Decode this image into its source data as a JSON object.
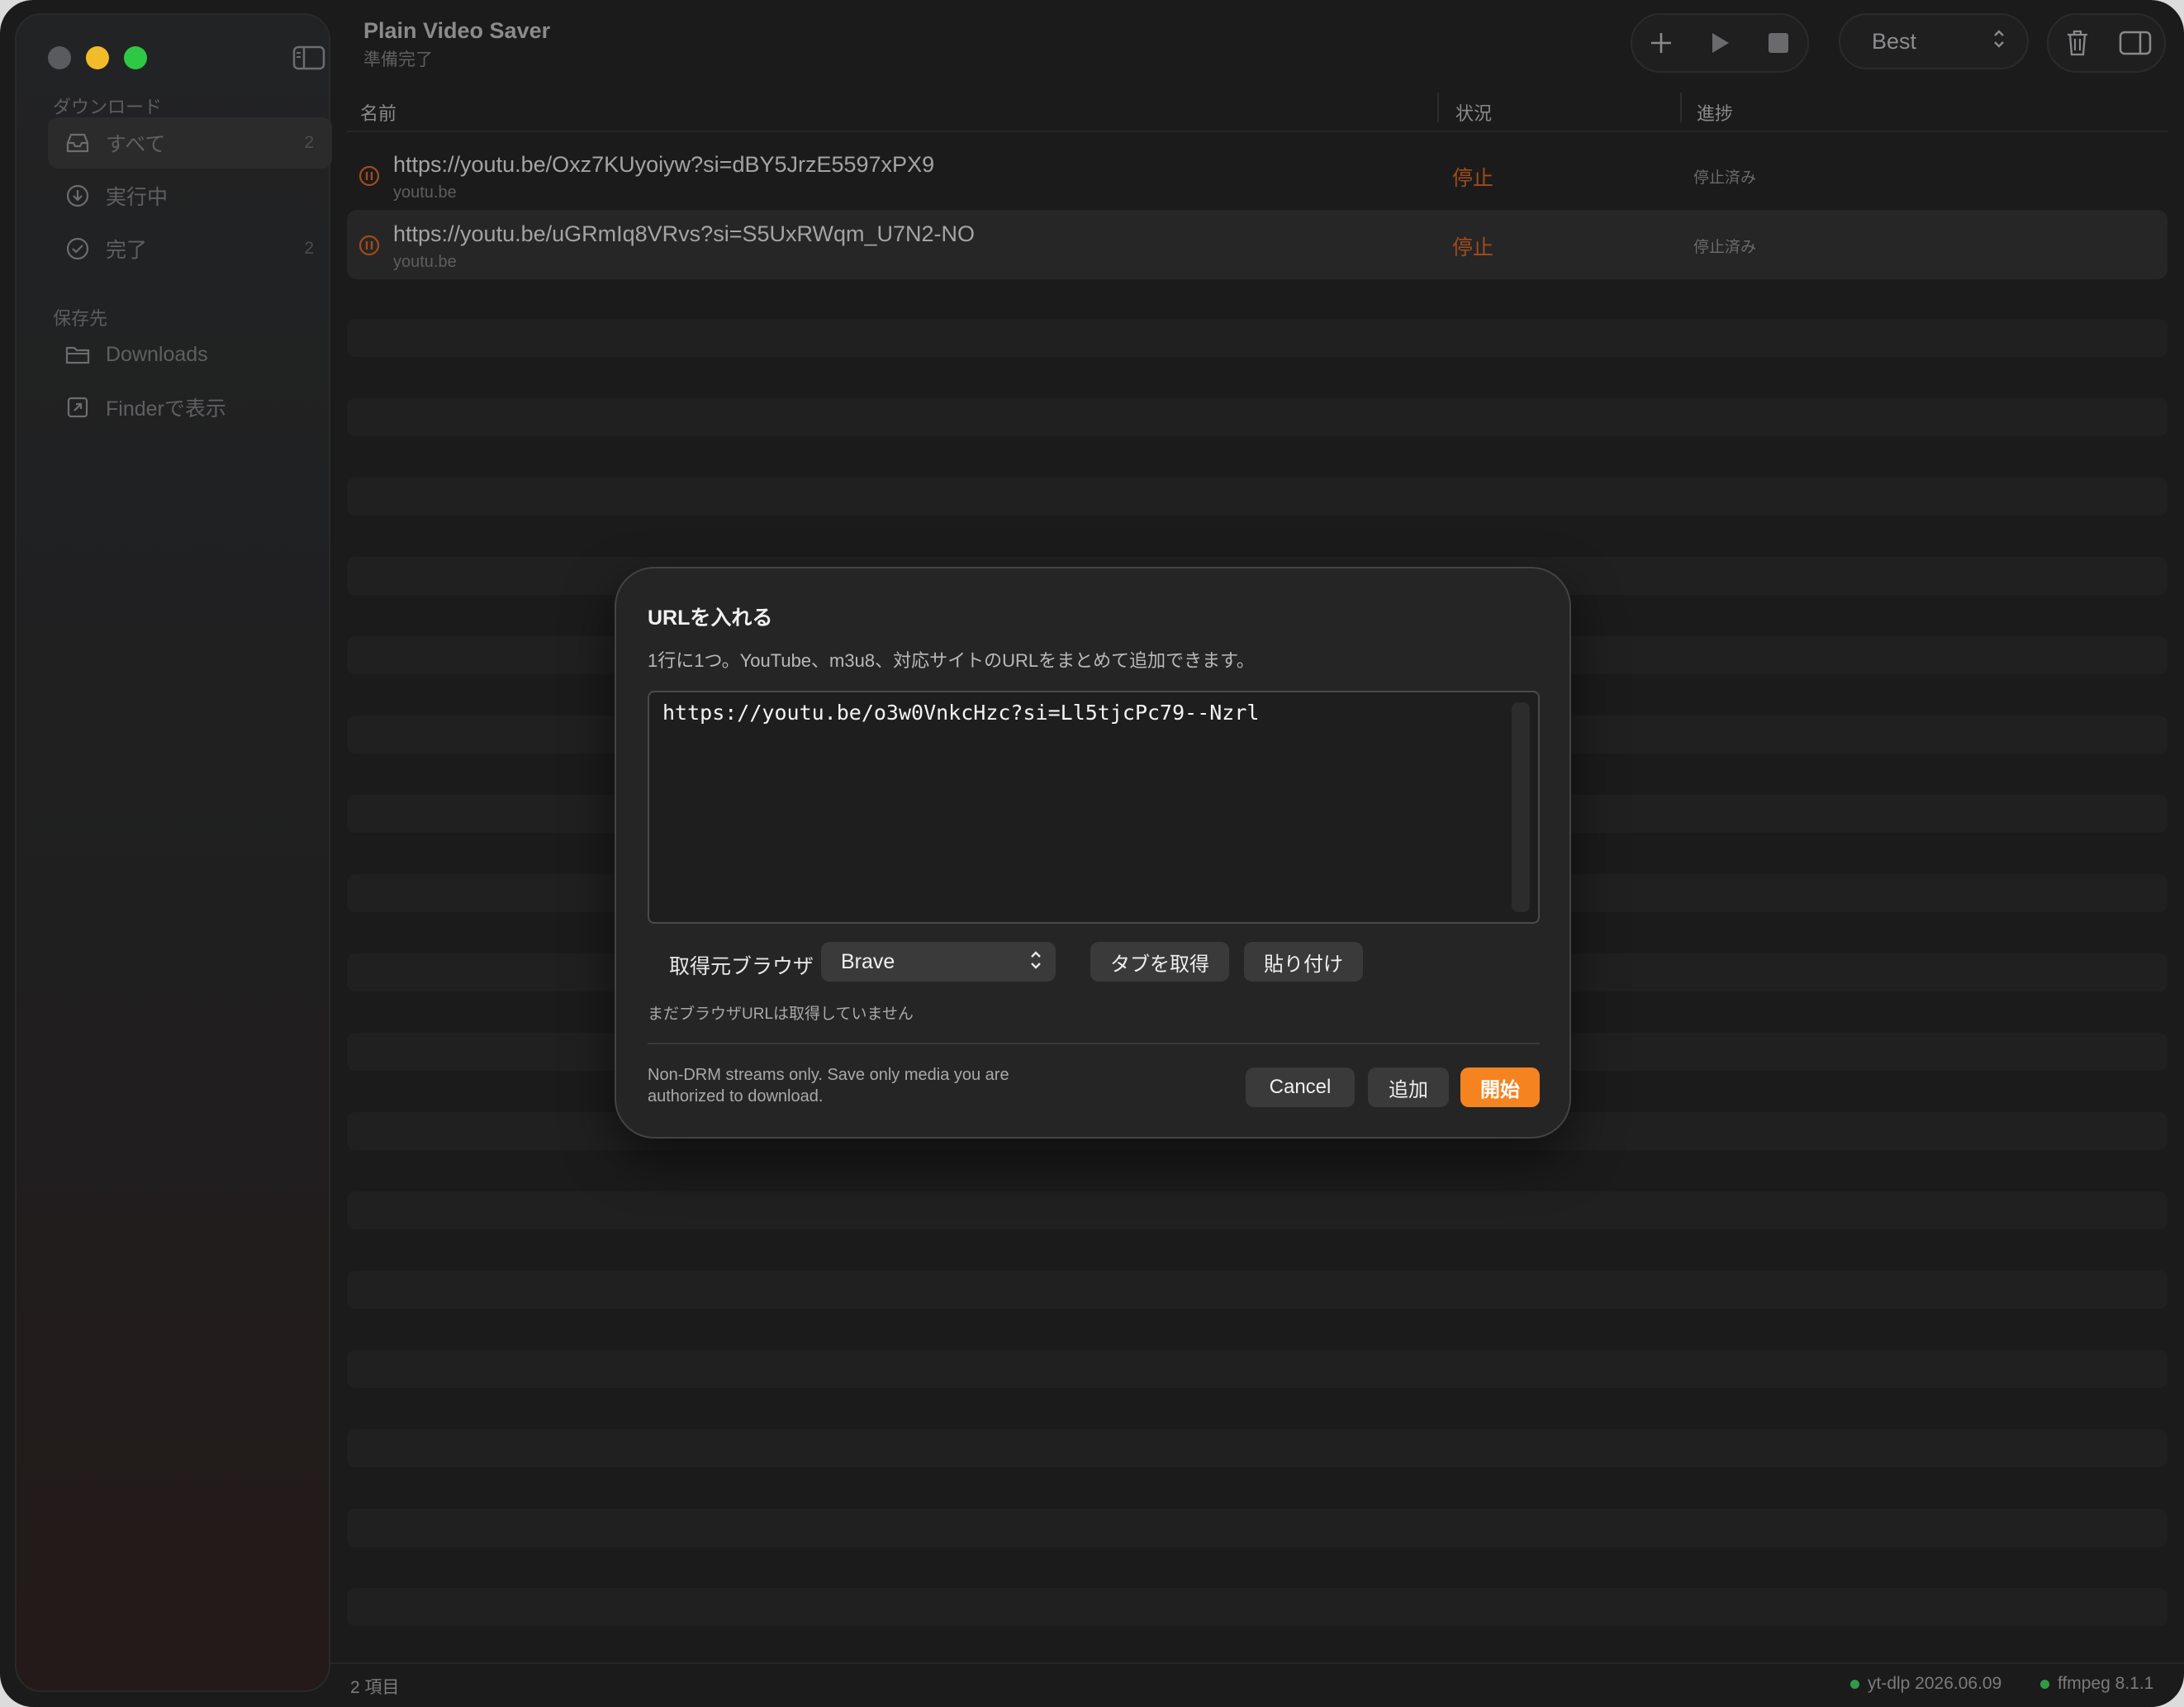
{
  "window": {
    "title": "Plain Video Saver",
    "subtitle": "準備完了"
  },
  "sidebar": {
    "downloads_section": "ダウンロード",
    "items": [
      {
        "label": "すべて",
        "count": "2",
        "icon": "tray-icon"
      },
      {
        "label": "実行中",
        "count": "",
        "icon": "download-circle-icon"
      },
      {
        "label": "完了",
        "count": "2",
        "icon": "checkmark-circle-icon"
      }
    ],
    "save_section": "保存先",
    "save_items": [
      {
        "label": "Downloads",
        "icon": "folder-icon"
      },
      {
        "label": "Finderで表示",
        "icon": "open-external-icon"
      }
    ]
  },
  "toolbar": {
    "quality": "Best"
  },
  "table": {
    "columns": [
      "名前",
      "状況",
      "進捗"
    ],
    "rows": [
      {
        "url": "https://youtu.be/Oxz7KUyoiyw?si=dBY5JrzE5597xPX9",
        "host": "youtu.be",
        "status": "停止",
        "progress": "停止済み",
        "selected": false
      },
      {
        "url": "https://youtu.be/uGRmIq8VRvs?si=S5UxRWqm_U7N2-NO",
        "host": "youtu.be",
        "status": "停止",
        "progress": "停止済み",
        "selected": true
      }
    ]
  },
  "statusbar": {
    "count": "2 項目",
    "ytdlp": "yt-dlp 2026.06.09",
    "ffmpeg": "ffmpeg 8.1.1"
  },
  "dialog": {
    "title": "URLを入れる",
    "description": "1行に1つ。YouTube、m3u8、対応サイトのURLをまとめて追加できます。",
    "url_value": "https://youtu.be/o3w0VnkcHzc?si=Ll5tjcPc79--Nzrl",
    "browser_label": "取得元ブラウザ",
    "browser_value": "Brave",
    "fetch_tabs_label": "タブを取得",
    "paste_label": "貼り付け",
    "note": "まだブラウザURLは取得していません",
    "footer_line1": "Non-DRM streams only. Save only media you are",
    "footer_line2": "authorized to download.",
    "cancel_label": "Cancel",
    "add_label": "追加",
    "start_label": "開始"
  },
  "colors": {
    "accent": "#f5831f",
    "status_stopped": "#a04c1d",
    "status_ok": "#2f9b46"
  }
}
